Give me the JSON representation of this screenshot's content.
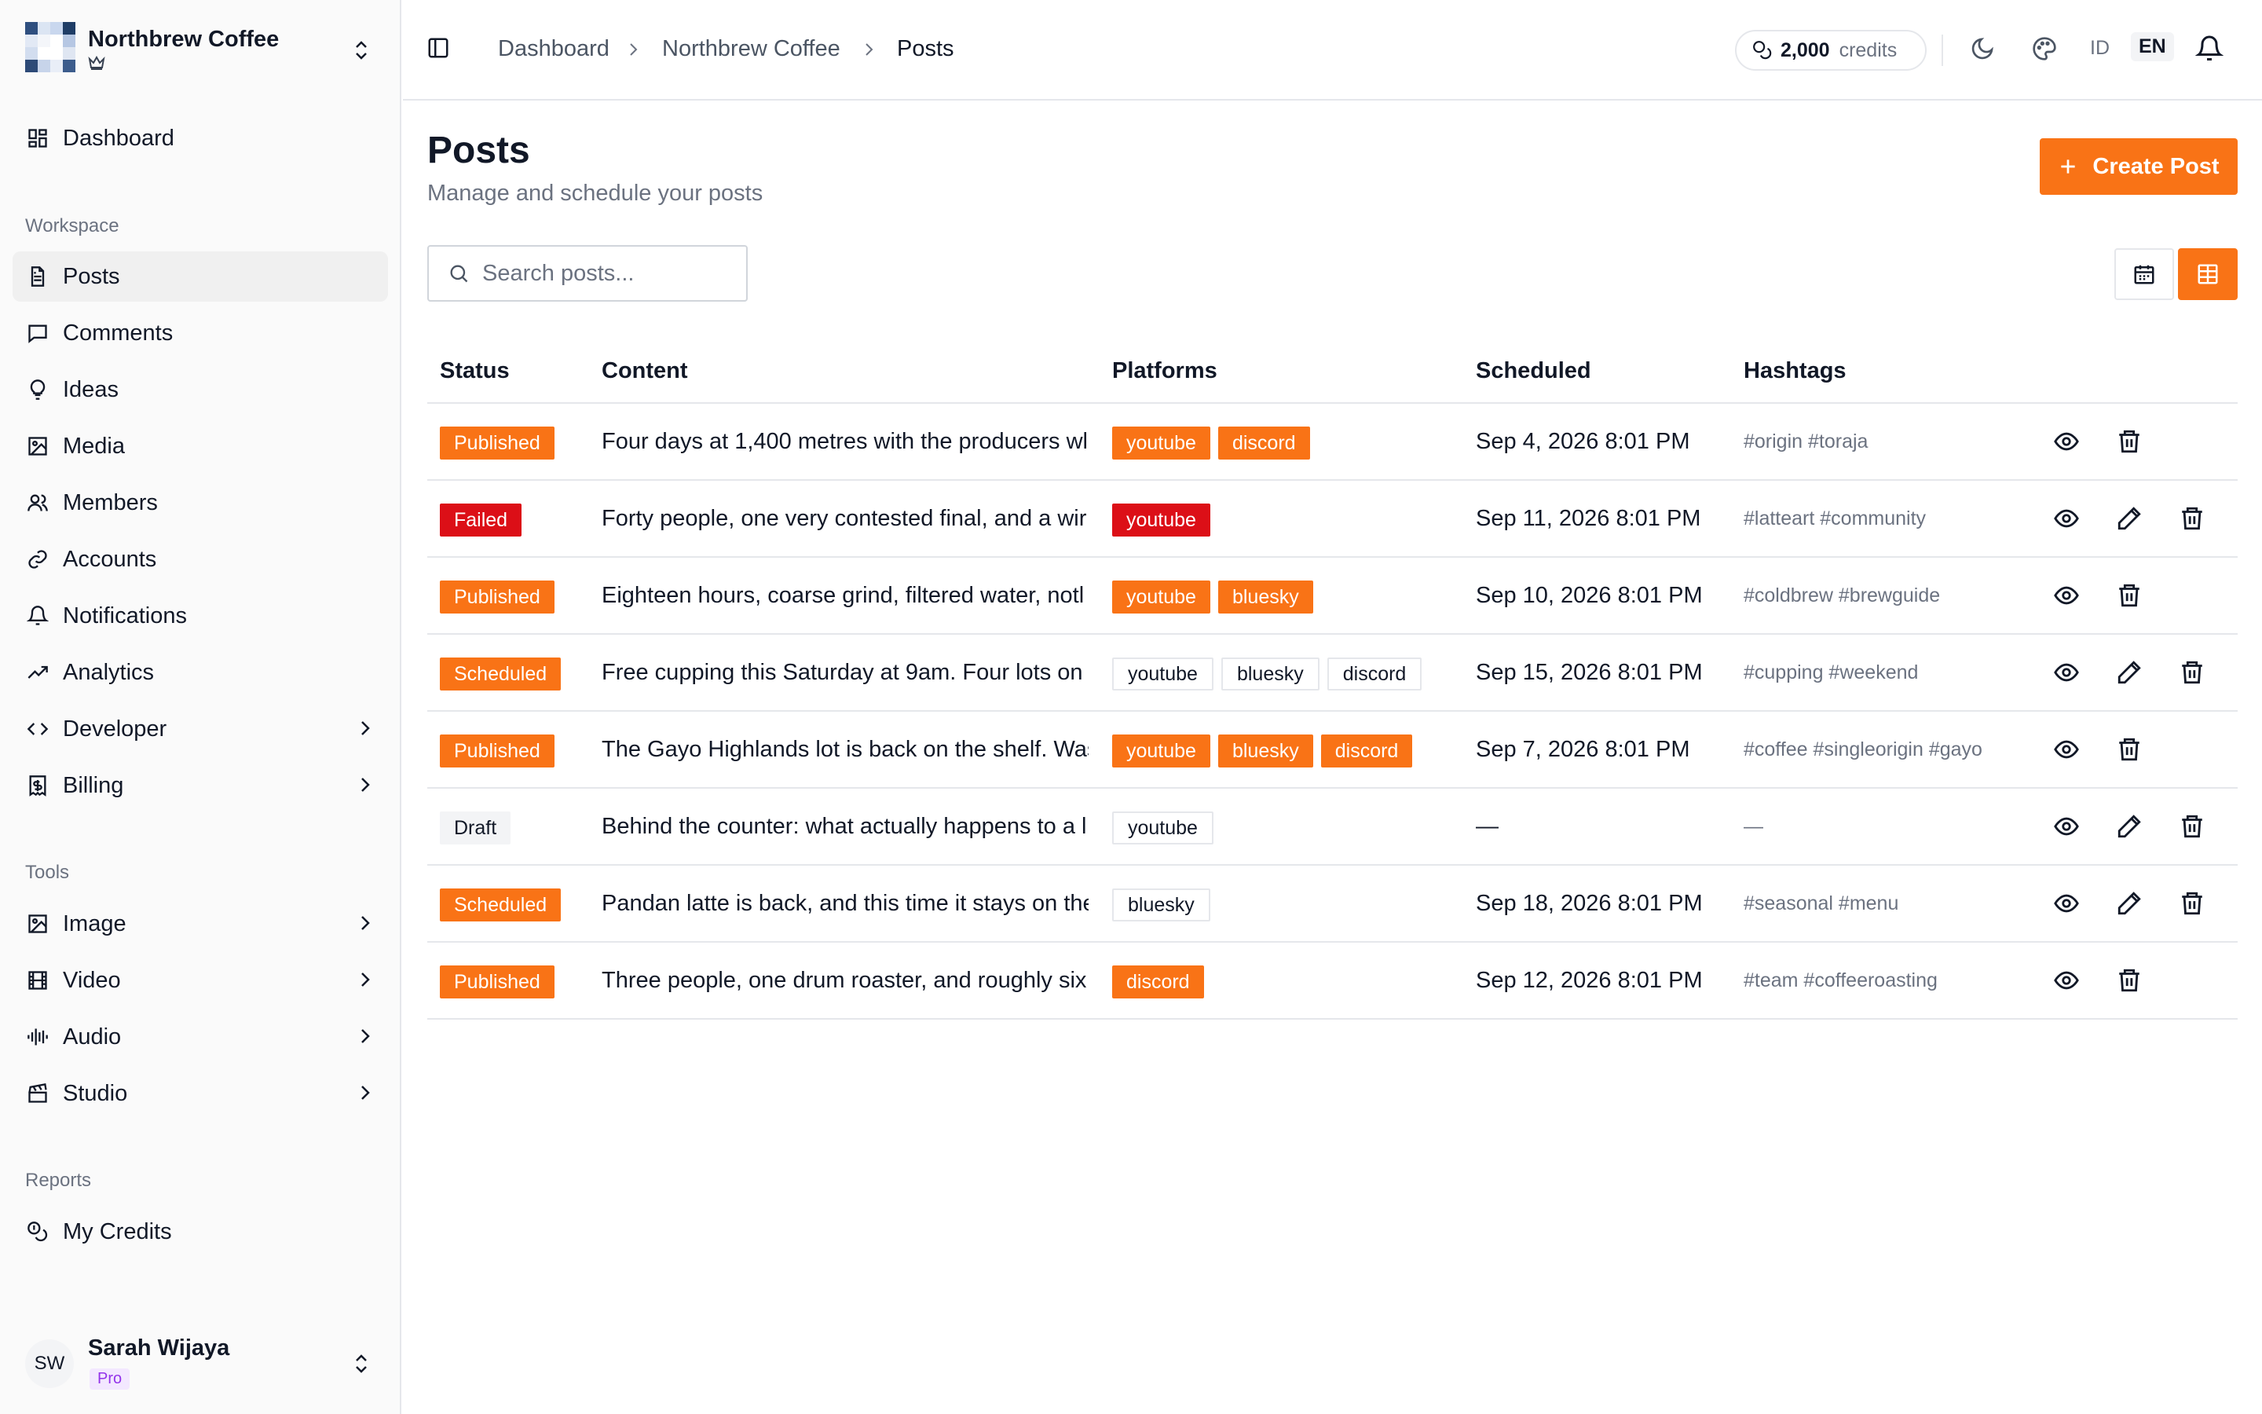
{
  "workspace": {
    "name": "Northbrew Coffee"
  },
  "nav": {
    "dashboard": "Dashboard",
    "workspace_label": "Workspace",
    "workspace_items": [
      {
        "label": "Posts",
        "icon": "file-text-icon",
        "active": true
      },
      {
        "label": "Comments",
        "icon": "message-square-icon"
      },
      {
        "label": "Ideas",
        "icon": "lightbulb-icon"
      },
      {
        "label": "Media",
        "icon": "image-icon"
      },
      {
        "label": "Members",
        "icon": "users-icon"
      },
      {
        "label": "Accounts",
        "icon": "link-icon"
      },
      {
        "label": "Notifications",
        "icon": "bell-icon"
      },
      {
        "label": "Analytics",
        "icon": "trending-up-icon"
      },
      {
        "label": "Developer",
        "icon": "code-icon",
        "has_submenu": true
      },
      {
        "label": "Billing",
        "icon": "receipt-icon",
        "has_submenu": true
      }
    ],
    "tools_label": "Tools",
    "tools_items": [
      {
        "label": "Image",
        "icon": "image-icon",
        "has_submenu": true
      },
      {
        "label": "Video",
        "icon": "film-icon",
        "has_submenu": true
      },
      {
        "label": "Audio",
        "icon": "audio-waveform-icon",
        "has_submenu": true
      },
      {
        "label": "Studio",
        "icon": "clapperboard-icon",
        "has_submenu": true
      }
    ],
    "reports_label": "Reports",
    "reports_items": [
      {
        "label": "My Credits",
        "icon": "coins-icon"
      }
    ]
  },
  "user": {
    "initials": "SW",
    "name": "Sarah Wijaya",
    "plan": "Pro"
  },
  "topbar": {
    "breadcrumbs": [
      "Dashboard",
      "Northbrew Coffee",
      "Posts"
    ],
    "credits_amount": "2,000",
    "credits_unit": "credits",
    "lang_id": "ID",
    "lang_en": "EN"
  },
  "page": {
    "title": "Posts",
    "subtitle": "Manage and schedule your posts",
    "create_label": "Create Post",
    "search_placeholder": "Search posts..."
  },
  "table": {
    "headers": [
      "Status",
      "Content",
      "Platforms",
      "Scheduled",
      "Hashtags"
    ],
    "rows": [
      {
        "status": "Published",
        "content": "Four days at 1,400 metres with the producers wl",
        "platforms": [
          {
            "name": "youtube",
            "style": "solid-orange"
          },
          {
            "name": "discord",
            "style": "solid-orange"
          }
        ],
        "scheduled": "Sep 4, 2026 8:01 PM",
        "hashtags": "#origin #toraja",
        "editable": false
      },
      {
        "status": "Failed",
        "content": "Forty people, one very contested final, and a wir",
        "platforms": [
          {
            "name": "youtube",
            "style": "solid-red"
          }
        ],
        "scheduled": "Sep 11, 2026 8:01 PM",
        "hashtags": "#latteart #community",
        "editable": true
      },
      {
        "status": "Published",
        "content": "Eighteen hours, coarse grind, filtered water, notl",
        "platforms": [
          {
            "name": "youtube",
            "style": "solid-orange"
          },
          {
            "name": "bluesky",
            "style": "solid-orange"
          }
        ],
        "scheduled": "Sep 10, 2026 8:01 PM",
        "hashtags": "#coldbrew #brewguide",
        "editable": false
      },
      {
        "status": "Scheduled",
        "content": "Free cupping this Saturday at 9am. Four lots on",
        "platforms": [
          {
            "name": "youtube",
            "style": "outline"
          },
          {
            "name": "bluesky",
            "style": "outline"
          },
          {
            "name": "discord",
            "style": "outline"
          }
        ],
        "scheduled": "Sep 15, 2026 8:01 PM",
        "hashtags": "#cupping #weekend",
        "editable": true
      },
      {
        "status": "Published",
        "content": "The Gayo Highlands lot is back on the shelf. Was",
        "platforms": [
          {
            "name": "youtube",
            "style": "solid-orange"
          },
          {
            "name": "bluesky",
            "style": "solid-orange"
          },
          {
            "name": "discord",
            "style": "solid-orange"
          }
        ],
        "scheduled": "Sep 7, 2026 8:01 PM",
        "hashtags": "#coffee #singleorigin #gayo",
        "editable": false
      },
      {
        "status": "Draft",
        "content": "Behind the counter: what actually happens to a l",
        "platforms": [
          {
            "name": "youtube",
            "style": "outline"
          }
        ],
        "scheduled": "—",
        "hashtags": "—",
        "editable": true
      },
      {
        "status": "Scheduled",
        "content": "Pandan latte is back, and this time it stays on the",
        "platforms": [
          {
            "name": "bluesky",
            "style": "outline"
          }
        ],
        "scheduled": "Sep 18, 2026 8:01 PM",
        "hashtags": "#seasonal #menu",
        "editable": true
      },
      {
        "status": "Published",
        "content": "Three people, one drum roaster, and roughly six",
        "platforms": [
          {
            "name": "discord",
            "style": "solid-orange"
          }
        ],
        "scheduled": "Sep 12, 2026 8:01 PM",
        "hashtags": "#team #coffeeroasting",
        "editable": false
      }
    ]
  },
  "colors": {
    "accent": "#f97316",
    "danger": "#dc0f17",
    "plan_bg": "#f3e8ff",
    "plan_fg": "#9333ea"
  }
}
